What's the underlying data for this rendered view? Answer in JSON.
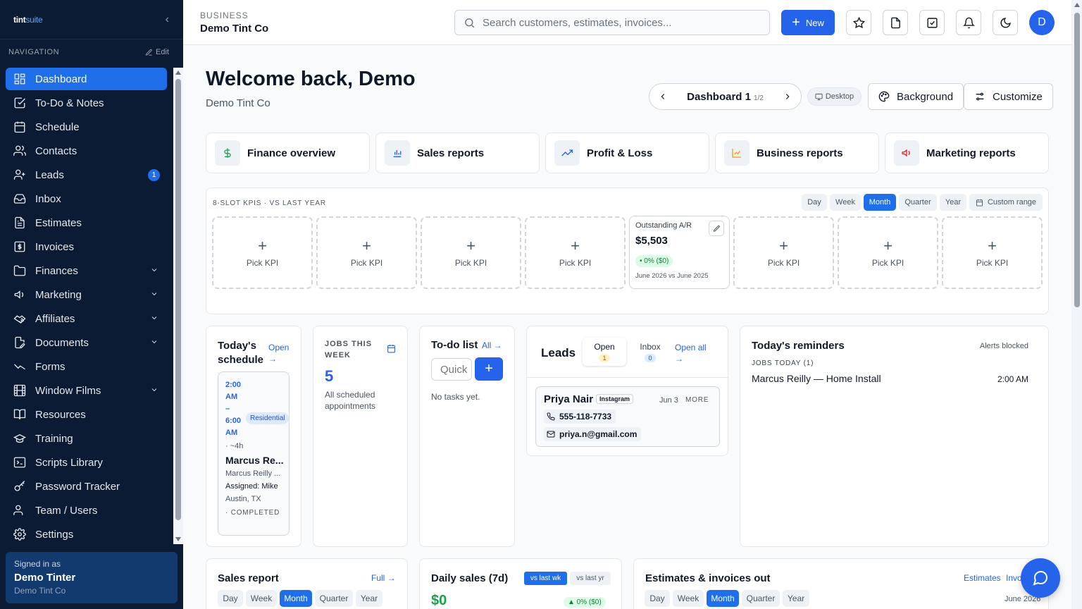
{
  "sidebar": {
    "logo_main": "tint",
    "logo_accent": "suite",
    "nav_heading": "NAVIGATION",
    "edit_label": "Edit",
    "items": [
      {
        "label": "Dashboard",
        "icon": "dashboard-icon",
        "active": true
      },
      {
        "label": "To-Do & Notes",
        "icon": "checkbox-icon"
      },
      {
        "label": "Schedule",
        "icon": "calendar-icon"
      },
      {
        "label": "Contacts",
        "icon": "users-icon"
      },
      {
        "label": "Leads",
        "icon": "user-plus-icon",
        "badge": "1"
      },
      {
        "label": "Inbox",
        "icon": "inbox-icon"
      },
      {
        "label": "Estimates",
        "icon": "file-text-icon"
      },
      {
        "label": "Invoices",
        "icon": "dollar-receipt-icon"
      },
      {
        "label": "Finances",
        "icon": "folder-icon",
        "expandable": true
      },
      {
        "label": "Marketing",
        "icon": "megaphone-icon",
        "expandable": true
      },
      {
        "label": "Affiliates",
        "icon": "handshake-icon",
        "expandable": true
      },
      {
        "label": "Documents",
        "icon": "document-edit-icon",
        "expandable": true
      },
      {
        "label": "Forms",
        "icon": "trend-icon"
      },
      {
        "label": "Window Films",
        "icon": "film-icon",
        "expandable": true
      },
      {
        "label": "Resources",
        "icon": "book-icon"
      },
      {
        "label": "Training",
        "icon": "graduation-cap-icon"
      },
      {
        "label": "Scripts Library",
        "icon": "terminal-icon"
      },
      {
        "label": "Password Tracker",
        "icon": "key-icon"
      },
      {
        "label": "Team / Users",
        "icon": "team-icon"
      },
      {
        "label": "Settings",
        "icon": "gear-icon"
      }
    ],
    "signed_in": {
      "label": "Signed in as",
      "name": "Demo Tinter",
      "company": "Demo Tint Co"
    }
  },
  "topbar": {
    "biz_label": "BUSINESS",
    "biz_name": "Demo Tint Co",
    "search_placeholder": "Search customers, estimates, invoices...",
    "new_label": "New",
    "avatar_initial": "D"
  },
  "welcome": {
    "title": "Welcome back, Demo",
    "subtitle": "Demo Tint Co",
    "dashboard_name": "Dashboard 1",
    "dashboard_page": "1/2",
    "device_label": "Desktop",
    "background_label": "Background",
    "customize_label": "Customize"
  },
  "reports": [
    {
      "label": "Finance overview",
      "icon": "dollar-icon",
      "color": "#16a34a"
    },
    {
      "label": "Sales reports",
      "icon": "bar-chart-icon",
      "color": "#2563eb"
    },
    {
      "label": "Profit & Loss",
      "icon": "trending-up-icon",
      "color": "#2563eb"
    },
    {
      "label": "Business reports",
      "icon": "line-chart-icon",
      "color": "#f59e0b"
    },
    {
      "label": "Marketing reports",
      "icon": "megaphone-icon",
      "color": "#dc2626"
    }
  ],
  "kpi": {
    "title": "8-SLOT KPIS · VS LAST YEAR",
    "periods": [
      "Day",
      "Week",
      "Month",
      "Quarter",
      "Year"
    ],
    "active_period": "Month",
    "custom_range": "Custom range",
    "pick_label": "Pick KPI",
    "filled": {
      "label": "Outstanding A/R",
      "value": "$5,503",
      "change": "• 0% ($0)",
      "compare": "June 2026 vs June 2025"
    }
  },
  "schedule": {
    "title": "Today's schedule",
    "open_link": "Open →",
    "time": "2:00 AM – 6:00 AM",
    "duration": "· ~4h",
    "tag": "Residential",
    "customer": "Marcus Re...",
    "customer_sub": "Marcus Reilly ...",
    "assigned_label": "Assigned:",
    "assigned_name": "Mike",
    "location": "Austin, TX",
    "status": "· COMPLETED"
  },
  "jobs": {
    "label": "JOBS THIS WEEK",
    "value": "5",
    "sub": "All scheduled appointments"
  },
  "todo": {
    "title": "To-do list",
    "all_link": "All →",
    "input_placeholder": "Quick",
    "empty": "No tasks yet."
  },
  "leads": {
    "title": "Leads",
    "tab_open": "Open",
    "open_count": "1",
    "tab_inbox": "Inbox",
    "inbox_count": "0",
    "open_all": "Open all →",
    "item": {
      "name": "Priya Nair",
      "source": "Instagram",
      "date": "Jun 3",
      "more": "MORE",
      "phone": "555-118-7733",
      "email": "priya.n@gmail.com"
    }
  },
  "reminders": {
    "title": "Today's reminders",
    "status": "Alerts blocked",
    "section": "JOBS TODAY (1)",
    "item": "Marcus Reilly — Home Install",
    "item_time": "2:00 AM"
  },
  "sales": {
    "title": "Sales report",
    "link": "Full →",
    "periods": [
      "Day",
      "Week",
      "Month",
      "Quarter",
      "Year"
    ],
    "active": "Month"
  },
  "daily": {
    "title": "Daily sales (7d)",
    "vs_week": "vs last wk",
    "vs_year": "vs last yr",
    "value": "$0",
    "change": "▲ 0% ($0)"
  },
  "estimates": {
    "title": "Estimates & invoices out",
    "link1": "Estimates",
    "link2": "Invoices",
    "periods": [
      "Day",
      "Week",
      "Month",
      "Quarter",
      "Year"
    ],
    "active": "Month",
    "month": "June 2026"
  }
}
